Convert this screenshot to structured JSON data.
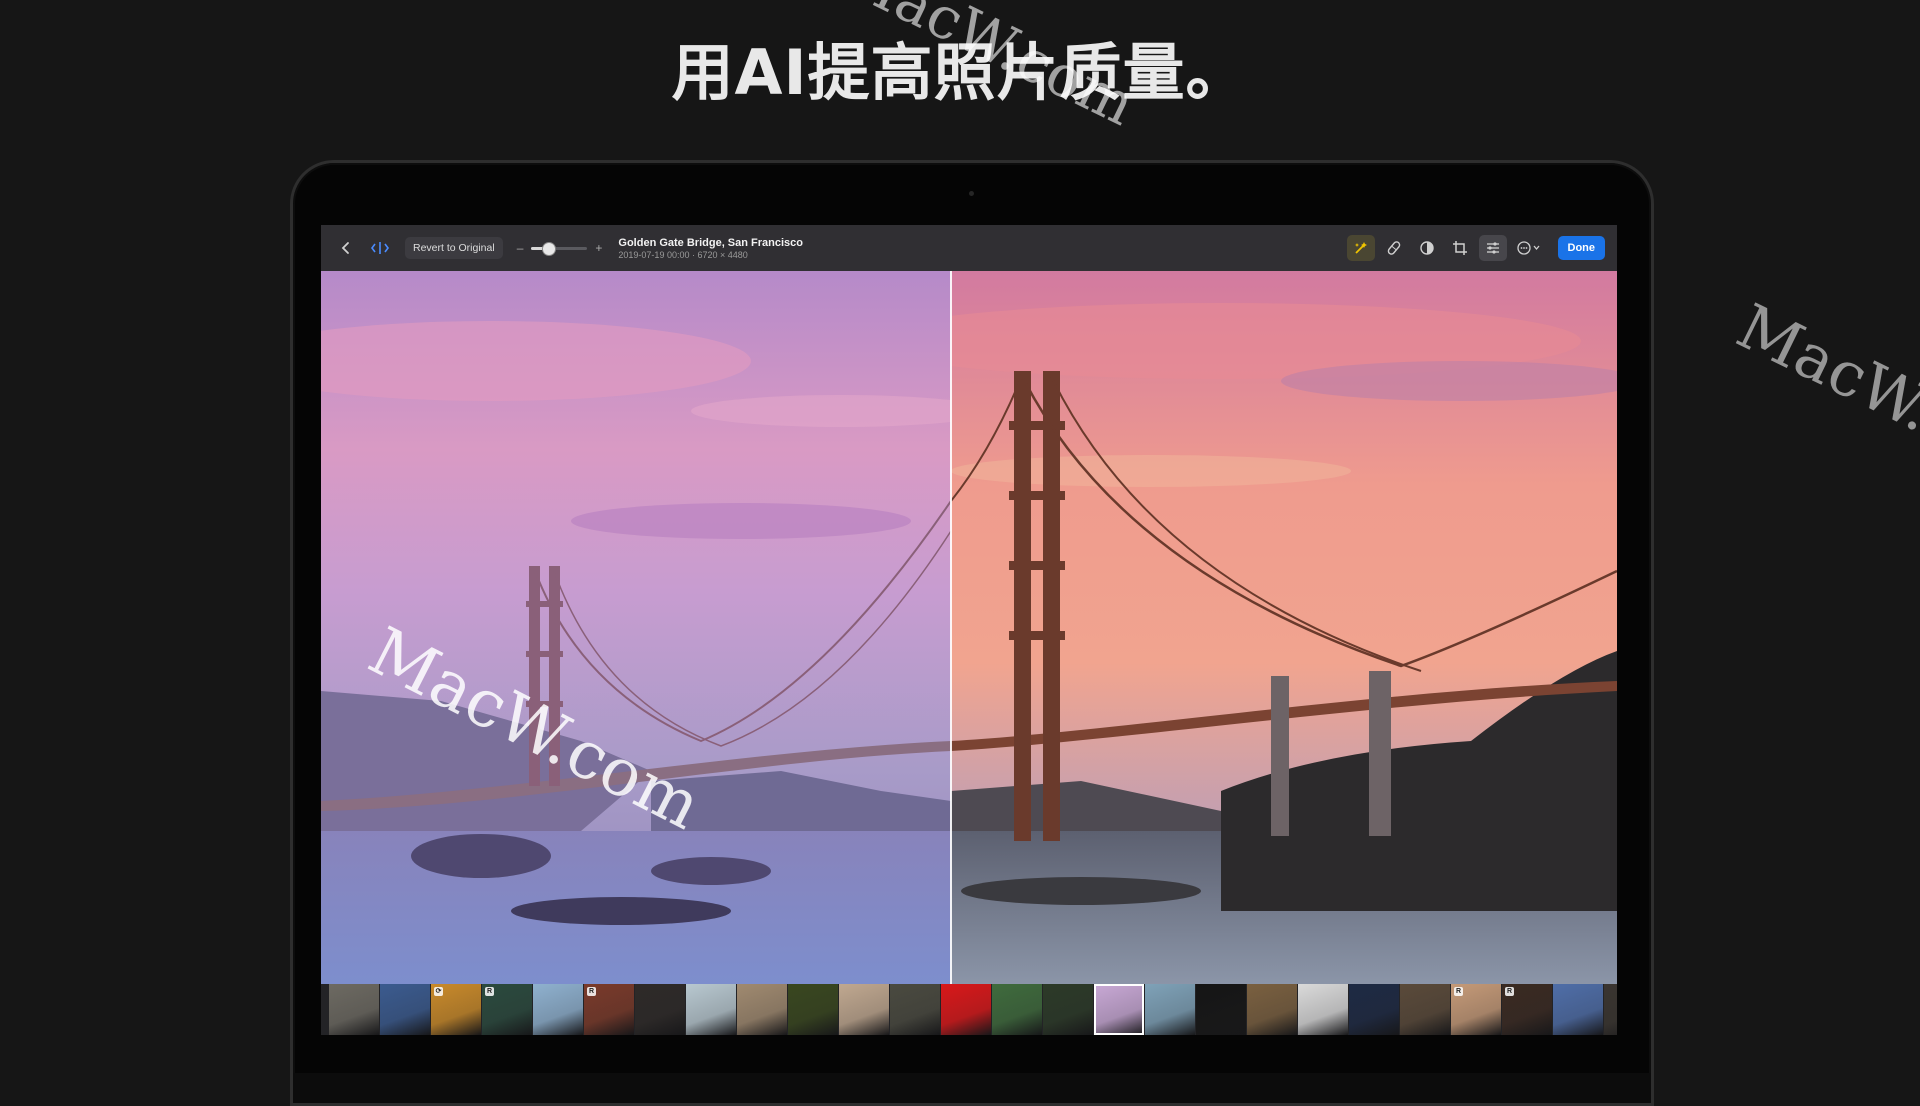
{
  "headline": "用AI提高照片质量。",
  "watermark": "MacW.com",
  "toolbar": {
    "back_icon": "chevron-left-icon",
    "compare_icon": "compare-split-icon",
    "revert_label": "Revert to Original",
    "slider_minus": "–",
    "slider_plus": "+",
    "slider_value": 0.3,
    "photo_title": "Golden Gate Bridge, San Francisco",
    "photo_meta": "2019-07-19 00:00 · 6720 × 4480",
    "tools": [
      "enhance-icon",
      "retouch-icon",
      "mask-icon",
      "crop-icon",
      "adjust-icon",
      "more-icon"
    ],
    "done_label": "Done"
  },
  "filmstrip": {
    "thumbnails": [
      {
        "color": "#6d6a62",
        "badge": ""
      },
      {
        "color": "#3b5b8f",
        "badge": ""
      },
      {
        "color": "#c98a2a",
        "badge": "⟳"
      },
      {
        "color": "#2b4a3e",
        "badge": "R"
      },
      {
        "color": "#8fb1cf",
        "badge": ""
      },
      {
        "color": "#7a3a2a",
        "badge": "R"
      },
      {
        "color": "#2e2a28",
        "badge": ""
      },
      {
        "color": "#b8c8d0",
        "badge": ""
      },
      {
        "color": "#a08a70",
        "badge": ""
      },
      {
        "color": "#39471f",
        "badge": ""
      },
      {
        "color": "#c0a890",
        "badge": ""
      },
      {
        "color": "#4a4a40",
        "badge": ""
      },
      {
        "color": "#d9181a",
        "badge": ""
      },
      {
        "color": "#3f6b3d",
        "badge": ""
      },
      {
        "color": "#2c3a28",
        "badge": ""
      },
      {
        "color": "#c9a9d6",
        "badge": ""
      },
      {
        "color": "#7fa2b8",
        "badge": ""
      },
      {
        "color": "#151515",
        "badge": ""
      },
      {
        "color": "#7a6040",
        "badge": ""
      },
      {
        "color": "#dadada",
        "badge": ""
      },
      {
        "color": "#1e2a44",
        "badge": ""
      },
      {
        "color": "#5a4a3a",
        "badge": ""
      },
      {
        "color": "#c59a78",
        "badge": "R"
      },
      {
        "color": "#3a2a22",
        "badge": "R"
      },
      {
        "color": "#4f6ea8",
        "badge": ""
      },
      {
        "color": "#3a3530",
        "badge": ""
      }
    ],
    "current_index": 15
  }
}
